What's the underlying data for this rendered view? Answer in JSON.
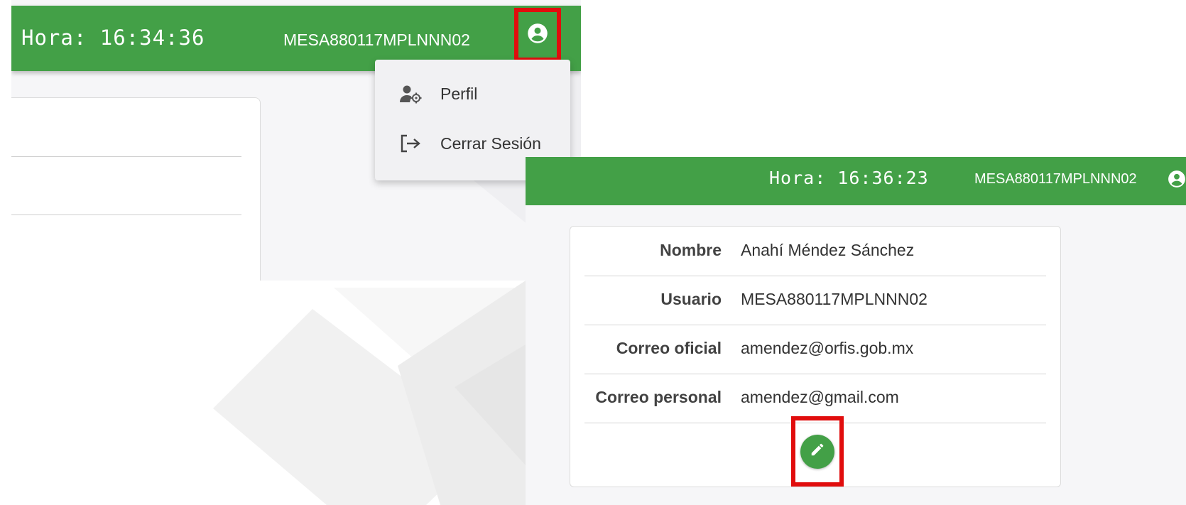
{
  "screen1": {
    "clock_text": "Hora: 16:34:36",
    "user": "MESA880117MPLNNN02",
    "account_icon": "account-circle-icon",
    "menu": [
      {
        "label": "Perfil",
        "icon": "user-cog-icon"
      },
      {
        "label": "Cerrar Sesión",
        "icon": "logout-icon"
      }
    ]
  },
  "screen2": {
    "clock_text": "Hora: 16:36:23",
    "user": "MESA880117MPLNNN02",
    "account_icon": "account-circle-icon",
    "profile": [
      {
        "label": "Nombre",
        "value": "Anahí Méndez Sánchez"
      },
      {
        "label": "Usuario",
        "value": "MESA880117MPLNNN02"
      },
      {
        "label": "Correo oficial",
        "value": "amendez@orfis.gob.mx"
      },
      {
        "label": "Correo personal",
        "value": "amendez@gmail.com"
      }
    ],
    "edit_icon": "pencil-icon"
  },
  "colors": {
    "header_green": "#43a047",
    "highlight_red": "#e10d0d"
  }
}
